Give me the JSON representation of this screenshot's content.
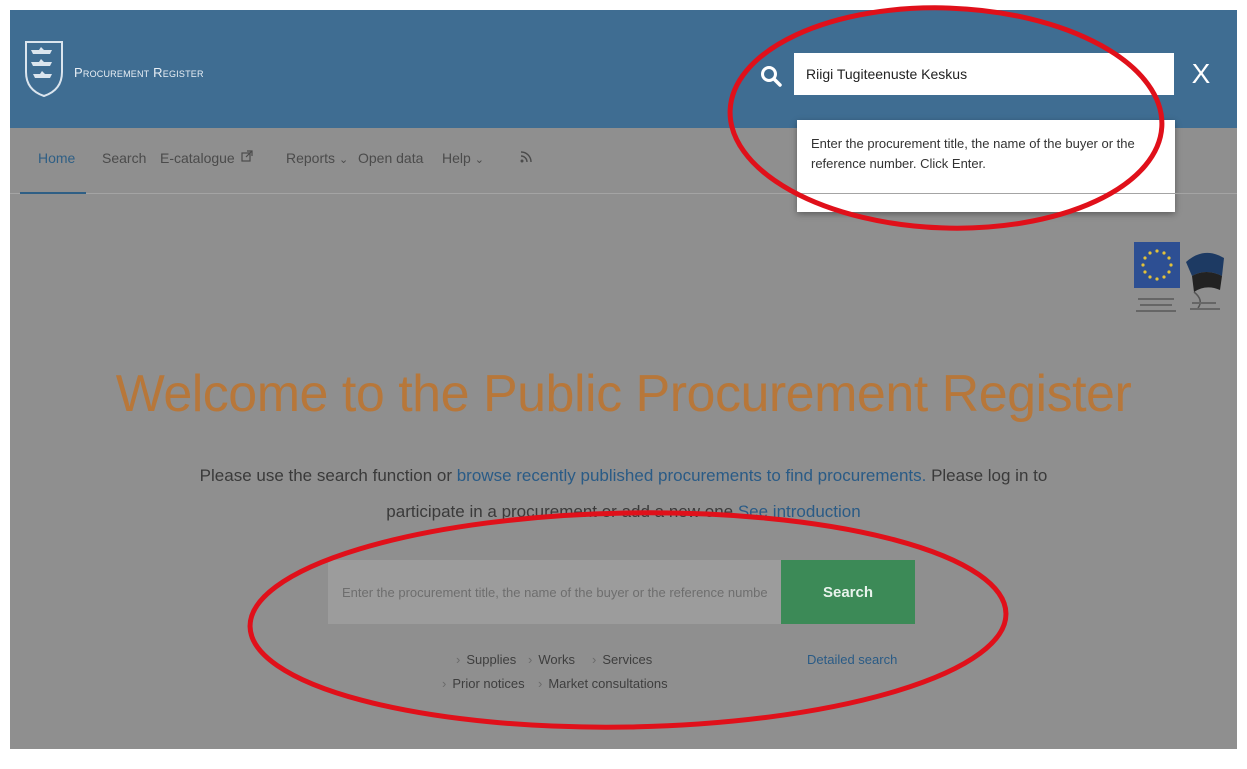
{
  "header": {
    "brand": "Procurement Register",
    "search_value": "Riigi Tugiteenuste Keskus",
    "close_label": "X",
    "tooltip": "Enter the procurement title, the name of the buyer or the reference number. Click Enter.",
    "bg_color": "#3f6d92"
  },
  "nav": {
    "items": [
      {
        "label": "Home",
        "active": true
      },
      {
        "label": "Search"
      },
      {
        "label": "E-catalogue",
        "icon": "external-link-icon"
      },
      {
        "label": "Reports",
        "icon": "chevron-down-icon"
      },
      {
        "label": "Open data"
      },
      {
        "label": "Help",
        "icon": "chevron-down-icon"
      },
      {
        "label": "",
        "icon": "rss-icon"
      }
    ]
  },
  "hero": {
    "title": "Welcome to the Public Procurement Register",
    "text_1": "Please use the search function or ",
    "link_1": "browse recently published procurements to find procurements.",
    "text_2": " Please log in to participate in a procurement or add a new one ",
    "link_2": "See introduction"
  },
  "main_search": {
    "placeholder": "Enter the procurement title, the name of the buyer or the reference number",
    "button_label": "Search",
    "quick_links": [
      "Supplies",
      "Works",
      "Services",
      "Prior notices",
      "Market consultations"
    ],
    "detailed_search": "Detailed search"
  },
  "colors": {
    "title": "#b7773a",
    "link": "#2a5b86",
    "search_button": "#3c8a57",
    "annotation": "#e0101a"
  }
}
